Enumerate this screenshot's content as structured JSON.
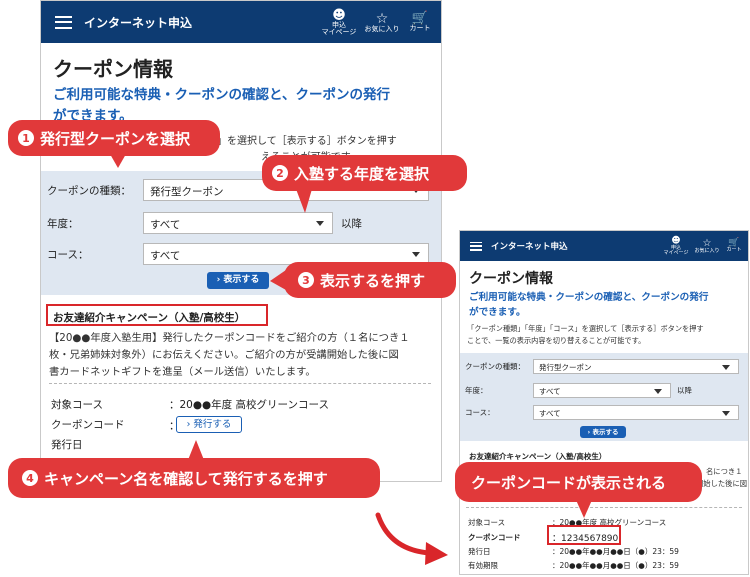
{
  "app": {
    "header_title": "インターネット申込",
    "icons": [
      {
        "name": "user-icon",
        "label1": "申込",
        "label2": "マイページ"
      },
      {
        "name": "star-icon",
        "label1": "お気に入り",
        "label2": ""
      },
      {
        "name": "cart-icon",
        "label1": "カート",
        "label2": ""
      }
    ]
  },
  "page": {
    "title": "クーポン情報",
    "lead1": "ご利用可能な特典・クーポンの確認と、クーポンの発行",
    "lead2": "ができます。",
    "desc1": "「クーポン種類」「年度」「コース」を選択して［表示する］ボタンを押す",
    "desc2": "ことで、一覧の表示内容を切り替えることが可能です。",
    "left_desc_frag": "」を選択して［表示する］ボタンを押す",
    "left_desc_frag2": "えることが可能です。"
  },
  "form": {
    "coupon_type_label": "クーポンの種類：",
    "coupon_type_value": "発行型クーポン",
    "year_label": "年度：",
    "year_value": "すべて",
    "year_suffix": "以降",
    "course_label": "コース：",
    "course_value": "すべて",
    "show_button": "表示する"
  },
  "campaign": {
    "title": "お友達紹介キャンペーン（入塾/高校生）",
    "body1": "【20●●年度入塾生用】発行したクーポンコードをご紹介の方（１名につき１",
    "body2": "枚・兄弟姉妹対象外）にお伝えください。ご紹介の方が受講開始した後に図",
    "body3": "書カードネットギフトを進呈（メール送信）いたします。",
    "right_frag1": "名につき１",
    "right_frag2": "開始した後に図",
    "target_label": "対象コース",
    "target_value": "：20●●年度 高校グリーンコース",
    "code_label": "クーポンコード",
    "code_sep": "：",
    "issue_button": "発行する",
    "issue_date_label": "発行日",
    "issue_date_value": "：20●●年●●月●●日（●）23：59",
    "expiry_label": "有効期限",
    "expiry_value": "：20●●年●●月●●日（●）23：59",
    "code_value": "：1234567890"
  },
  "callouts": {
    "c1_num": "1",
    "c1": "発行型クーポンを選択",
    "c2_num": "2",
    "c2": "入塾する年度を選択",
    "c3_num": "3",
    "c3": "表示するを押す",
    "c4_num": "4",
    "c4": "キャンペーン名を確認して発行するを押す",
    "c5": "クーポンコードが表示される"
  },
  "colors": {
    "header": "#0d3b72",
    "accent": "#1a5fb4",
    "callout": "#e1393a"
  }
}
